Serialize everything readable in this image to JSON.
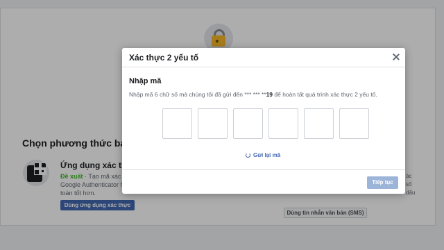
{
  "background": {
    "method_title": "Chọn phương thức bảo mật",
    "app_option": {
      "title": "Ứng dụng xác thực",
      "recommended": "Đề xuất",
      "desc_part1": " · Tạo mã xác thực",
      "desc_line2": "Google Authenticator hoặc",
      "desc_line3": "toàn tốt hơn.",
      "button_label": "Dùng ứng dụng xác thực",
      "icon": "qr-code-icon"
    },
    "right_snippet": [
      "ác",
      "số",
      "dấu"
    ],
    "sms_button_label": "Dùng tin nhắn văn bản (SMS)",
    "lock_icon": "lock-icon"
  },
  "modal": {
    "title": "Xác thực 2 yếu tố",
    "section_title": "Nhập mã",
    "instructions_prefix": "Nhập mã 6 chữ số mà chúng tôi đã gửi đến *** *** **",
    "instructions_bold": "19",
    "instructions_suffix": " để hoàn tất quá trình xác thực 2 yếu tố.",
    "code_boxes": [
      "",
      "",
      "",
      "",
      "",
      ""
    ],
    "resend_label": "Gửi lại mã",
    "continue_label": "Tiếp tục"
  },
  "colors": {
    "accent": "#4267b2",
    "disabled_button": "#9cb4d8",
    "recommended": "#42b72a"
  }
}
